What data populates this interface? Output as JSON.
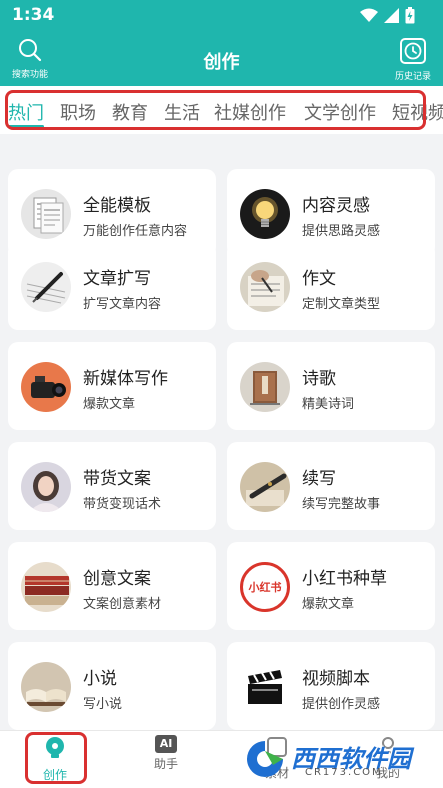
{
  "status_bar": {
    "time": "1:34"
  },
  "header": {
    "title": "创作",
    "search_label": "搜索功能",
    "history_label": "历史记录"
  },
  "tabs": [
    {
      "label": "热门",
      "active": true
    },
    {
      "label": "职场",
      "active": false
    },
    {
      "label": "教育",
      "active": false
    },
    {
      "label": "生活",
      "active": false
    },
    {
      "label": "社媒创作",
      "active": false
    },
    {
      "label": "文学创作",
      "active": false
    },
    {
      "label": "短视频",
      "active": false
    }
  ],
  "cards": [
    {
      "title": "全能模板",
      "subtitle": "万能创作任意内容",
      "icon": "document-template-icon"
    },
    {
      "title": "内容灵感",
      "subtitle": "提供思路灵感",
      "icon": "lightbulb-icon"
    },
    {
      "title": "文章扩写",
      "subtitle": "扩写文章内容",
      "icon": "pen-writing-icon"
    },
    {
      "title": "作文",
      "subtitle": "定制文章类型",
      "icon": "handwriting-icon"
    },
    {
      "title": "新媒体写作",
      "subtitle": "爆款文章",
      "icon": "video-camera-icon"
    },
    {
      "title": "诗歌",
      "subtitle": "精美诗词",
      "icon": "classic-book-icon"
    },
    {
      "title": "带货文案",
      "subtitle": "带货变现话术",
      "icon": "presenter-avatar-icon"
    },
    {
      "title": "续写",
      "subtitle": "续写完整故事",
      "icon": "fountain-pen-icon"
    },
    {
      "title": "创意文案",
      "subtitle": "文案创意素材",
      "icon": "books-stack-icon"
    },
    {
      "title": "小红书种草",
      "subtitle": "爆款文章",
      "icon": "xiaohongshu-logo-icon",
      "logo_text": "小红书"
    },
    {
      "title": "小说",
      "subtitle": "写小说",
      "icon": "open-book-icon"
    },
    {
      "title": "视频脚本",
      "subtitle": "提供创作灵感",
      "icon": "clapperboard-icon"
    }
  ],
  "bottom_nav": [
    {
      "label": "创作",
      "active": true,
      "icon": "bulb-create-icon"
    },
    {
      "label": "助手",
      "active": false,
      "icon": "ai-assistant-icon",
      "badge": "AI"
    },
    {
      "label": "素材",
      "active": false,
      "icon": "materials-icon"
    },
    {
      "label": "我的",
      "active": false,
      "icon": "profile-icon"
    }
  ],
  "watermark": {
    "text": "西西软件园",
    "subtext": "CR173.COM"
  },
  "colors": {
    "accent": "#1fb6ad",
    "highlight": "#d93030",
    "background": "#f2f3f5"
  }
}
